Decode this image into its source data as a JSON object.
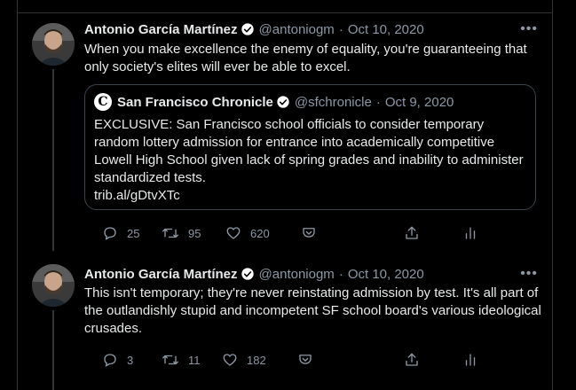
{
  "tweets": [
    {
      "author": "Antonio García Martínez",
      "handle": "@antoniogm",
      "separator": "·",
      "date": "Oct 10, 2020",
      "more": "•••",
      "text": "When you make excellence the enemy of equality, you're guaranteeing that only society's elites will ever be able to excel.",
      "quoted": {
        "logo": "C",
        "author": "San Francisco Chronicle",
        "handle": "@sfchronicle",
        "separator": "·",
        "date": "Oct 9, 2020",
        "text": "EXCLUSIVE: San Francisco school officials to consider temporary random lottery admission for entrance into academically competitive Lowell High School given lack of spring grades and inability to administer standardized tests.",
        "link": "trib.al/gDtvXTc"
      },
      "actions": {
        "replies": "25",
        "retweets": "95",
        "likes": "620"
      }
    },
    {
      "author": "Antonio García Martínez",
      "handle": "@antoniogm",
      "separator": "·",
      "date": "Oct 10, 2020",
      "more": "•••",
      "text": "This isn't temporary; they're never reinstating admission by test. It's all part of the outlandishly stupid and incompetent SF school board's various ideological crusades.",
      "actions": {
        "replies": "3",
        "retweets": "11",
        "likes": "182"
      }
    }
  ],
  "icons": {
    "verified": "verified-badge-icon",
    "reply": "reply-icon",
    "retweet": "retweet-icon",
    "like": "heart-icon",
    "bookmark": "bookmark-icon",
    "share": "share-icon",
    "analytics": "analytics-icon"
  },
  "colors": {
    "background": "#000000",
    "text": "#e7e9ea",
    "secondary": "#8b98a5",
    "border": "#2f3336",
    "verified": "#ffffff"
  }
}
